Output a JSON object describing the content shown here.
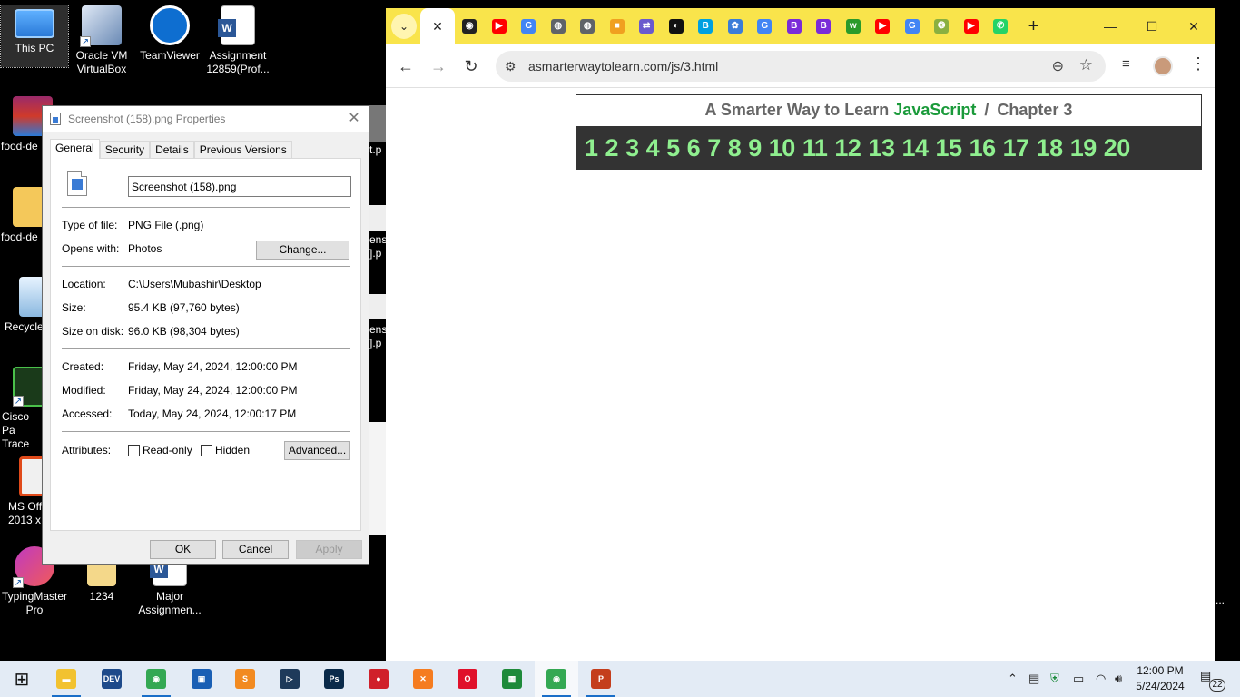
{
  "desktop": {
    "icons": [
      {
        "label": "This PC"
      },
      {
        "label": "Oracle VM VirtualBox"
      },
      {
        "label": "TeamViewer"
      },
      {
        "label": "Assignment 12859(Prof..."
      },
      {
        "label": "food-de"
      },
      {
        "label": "food-de"
      },
      {
        "label": "Recycle"
      },
      {
        "label": "Cisco Pa Trace"
      },
      {
        "label": "MS Off 2013 x"
      },
      {
        "label": "TypingMaster Pro"
      },
      {
        "label": "1234"
      },
      {
        "label": "Major Assignmen..."
      }
    ],
    "partial_labels": [
      "t.p",
      "ens",
      "].p",
      "ens",
      "].p",
      "..."
    ]
  },
  "dialog": {
    "title": "Screenshot (158).png Properties",
    "close_glyph": "✕",
    "tabs": [
      "General",
      "Security",
      "Details",
      "Previous Versions"
    ],
    "file_name": "Screenshot (158).png",
    "type_label": "Type of file:",
    "type_value": "PNG File (.png)",
    "opens_label": "Opens with:",
    "opens_value": "Photos",
    "change_button": "Change...",
    "location_label": "Location:",
    "location_value": "C:\\Users\\Mubashir\\Desktop",
    "size_label": "Size:",
    "size_value": "95.4 KB (97,760 bytes)",
    "size_disk_label": "Size on disk:",
    "size_disk_value": "96.0 KB (98,304 bytes)",
    "created_label": "Created:",
    "created_value": "Friday, May 24, 2024, 12:00:00 PM",
    "modified_label": "Modified:",
    "modified_value": "Friday, May 24, 2024, 12:00:00 PM",
    "accessed_label": "Accessed:",
    "accessed_value": "Today, May 24, 2024, 12:00:17 PM",
    "attributes_label": "Attributes:",
    "readonly_label": "Read-only",
    "hidden_label": "Hidden",
    "advanced_button": "Advanced...",
    "ok_button": "OK",
    "cancel_button": "Cancel",
    "apply_button": "Apply"
  },
  "browser": {
    "tab_search_glyph": "⌄",
    "active_tab_close": "✕",
    "favicons": [
      {
        "icon": "github-icon",
        "color": "#222222",
        "text": "◉"
      },
      {
        "icon": "youtube-icon",
        "color": "#ff0000",
        "text": "▶"
      },
      {
        "icon": "google-icon",
        "color": "#4285f4",
        "text": "G"
      },
      {
        "icon": "globe-icon",
        "color": "#5f6368",
        "text": "◍"
      },
      {
        "icon": "globe-icon",
        "color": "#5f6368",
        "text": "◍"
      },
      {
        "icon": "app-icon",
        "color": "#f0a020",
        "text": "■"
      },
      {
        "icon": "extension-icon",
        "color": "#6a5acd",
        "text": "⇄"
      },
      {
        "icon": "dark-icon",
        "color": "#111111",
        "text": "◐"
      },
      {
        "icon": "b-icon",
        "color": "#00a0e0",
        "text": "B"
      },
      {
        "icon": "site-icon",
        "color": "#3b7dd8",
        "text": "✿"
      },
      {
        "icon": "google-icon",
        "color": "#4285f4",
        "text": "G"
      },
      {
        "icon": "bootstrap-icon",
        "color": "#7a2bd8",
        "text": "B"
      },
      {
        "icon": "bootstrap-icon",
        "color": "#7a2bd8",
        "text": "B"
      },
      {
        "icon": "w-icon",
        "color": "#2a9a2a",
        "text": "w"
      },
      {
        "icon": "youtube-icon",
        "color": "#ff0000",
        "text": "▶"
      },
      {
        "icon": "google-icon",
        "color": "#4285f4",
        "text": "G"
      },
      {
        "icon": "emblem-icon",
        "color": "#8ab040",
        "text": "❂"
      },
      {
        "icon": "youtube-icon",
        "color": "#ff0000",
        "text": "▶"
      },
      {
        "icon": "whatsapp-icon",
        "color": "#25d366",
        "text": "✆"
      }
    ],
    "new_tab_glyph": "+",
    "minimize_glyph": "—",
    "maximize_glyph": "☐",
    "close_glyph": "✕",
    "back_glyph": "←",
    "forward_glyph": "→",
    "reload_glyph": "↻",
    "url": "asmarterwaytolearn.com/js/3.html",
    "tune_glyph": "⚙",
    "zoom_glyph": "⊖",
    "star_glyph": "☆",
    "media_glyph": "≡",
    "menu_glyph": "⋮",
    "page": {
      "title_prefix": "A Smarter Way to Learn",
      "title_js": "JavaScript",
      "title_sep": "/",
      "title_chapter": "Chapter 3",
      "chapters": [
        "1",
        "2",
        "3",
        "4",
        "5",
        "6",
        "7",
        "8",
        "9",
        "10",
        "11",
        "12",
        "13",
        "14",
        "15",
        "16",
        "17",
        "18",
        "19",
        "20"
      ]
    }
  },
  "taskbar": {
    "start_glyph": "⊞",
    "apps": [
      {
        "name": "file-explorer",
        "color": "#f2c230",
        "text": "▬"
      },
      {
        "name": "dev-cpp",
        "color": "#1e4a8a",
        "text": "DEV"
      },
      {
        "name": "chrome",
        "color": "#34a853",
        "text": "◉"
      },
      {
        "name": "virtualbox-app",
        "color": "#1a5fb4",
        "text": "▣"
      },
      {
        "name": "sublime-text",
        "color": "#f28a20",
        "text": "S"
      },
      {
        "name": "terminal-app",
        "color": "#1e3a5a",
        "text": "▷"
      },
      {
        "name": "photoshop",
        "color": "#0a2a4a",
        "text": "Ps"
      },
      {
        "name": "recorder-app",
        "color": "#d0202a",
        "text": "●"
      },
      {
        "name": "xampp",
        "color": "#f57c20",
        "text": "✕"
      },
      {
        "name": "opera",
        "color": "#e0102a",
        "text": "O"
      },
      {
        "name": "classroom-app",
        "color": "#1e8a3a",
        "text": "▦"
      },
      {
        "name": "chrome-active",
        "color": "#34a853",
        "text": "◉"
      },
      {
        "name": "powerpoint",
        "color": "#c43e1c",
        "text": "P"
      }
    ],
    "tray_chevron": "⌃",
    "tray_icons": [
      "▤",
      "⛨",
      "▭",
      "◠",
      "🔊︎"
    ],
    "time": "12:00 PM",
    "date": "5/24/2024",
    "notification_glyph": "▤",
    "notification_count": "22"
  }
}
